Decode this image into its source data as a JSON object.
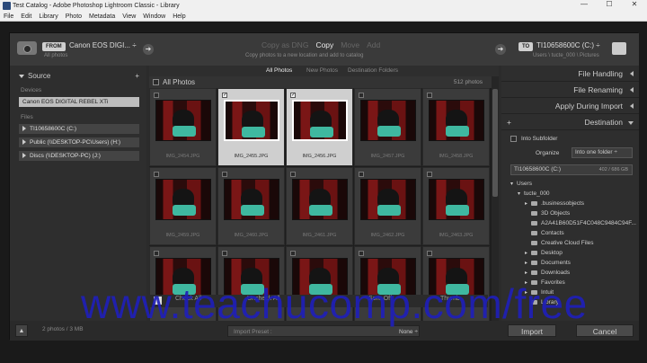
{
  "window": {
    "title": "Test Catalog - Adobe Photoshop Lightroom Classic - Library",
    "min": "—",
    "max": "☐",
    "close": "✕"
  },
  "menu": [
    "File",
    "Edit",
    "Library",
    "Photo",
    "Metadata",
    "View",
    "Window",
    "Help"
  ],
  "topbar": {
    "from_label": "FROM",
    "source_name": "Canon EOS DIGI... ÷",
    "source_sub": "All photos",
    "modes": [
      "Copy as DNG",
      "Copy",
      "Move",
      "Add"
    ],
    "active_mode": "Copy",
    "mode_sub": "Copy photos to a new location and add to catalog",
    "to_label": "TO",
    "dest_name": "TI10658600C (C:) ÷",
    "dest_sub": "Users \\ tucte_000 \\ Pictures",
    "arrow": "➜"
  },
  "source_panel": {
    "title": "Source",
    "plus": "+",
    "devices_label": "Devices",
    "device": "Canon EOS DIGITAL REBEL XTi",
    "files_label": "Files",
    "drives": [
      "TI10658600C (C:)",
      "Public (\\\\DESKTOP-PC\\Users) (H:)",
      "Discs (\\\\DESKTOP-PC) (J:)"
    ]
  },
  "tabs": [
    "All Photos",
    "New Photos",
    "Destination Folders"
  ],
  "active_tab": "All Photos",
  "grid": {
    "header": "All Photos",
    "count": "512 photos",
    "files": [
      {
        "name": "IMG_2454.JPG",
        "checked": false
      },
      {
        "name": "IMG_2455.JPG",
        "checked": true
      },
      {
        "name": "IMG_2456.JPG",
        "checked": true
      },
      {
        "name": "IMG_2457.JPG",
        "checked": false
      },
      {
        "name": "IMG_2458.JPG",
        "checked": false
      },
      {
        "name": "IMG_2459.JPG",
        "checked": false
      },
      {
        "name": "IMG_2460.JPG",
        "checked": false
      },
      {
        "name": "IMG_2461.JPG",
        "checked": false
      },
      {
        "name": "IMG_2462.JPG",
        "checked": false
      },
      {
        "name": "IMG_2463.JPG",
        "checked": false
      },
      {
        "name": "",
        "checked": false
      },
      {
        "name": "",
        "checked": false
      },
      {
        "name": "",
        "checked": false
      },
      {
        "name": "",
        "checked": false
      },
      {
        "name": "",
        "checked": false
      }
    ]
  },
  "right_panel": {
    "sections": [
      "File Handling",
      "File Renaming",
      "Apply During Import",
      "Destination"
    ],
    "plus": "+",
    "into_subfolder": "Into Subfolder",
    "organize_label": "Organize",
    "organize_value": "Into one folder ÷",
    "drive": "TI10658600C (C:)",
    "drive_space": "402 / 686 GB",
    "tree": [
      {
        "label": "Users",
        "level": 0,
        "expand": "▾"
      },
      {
        "label": "tucte_000",
        "level": 1,
        "expand": "▾"
      },
      {
        "label": ".businessobjects",
        "level": 2,
        "expand": "▸"
      },
      {
        "label": "3D Objects",
        "level": 2,
        "expand": ""
      },
      {
        "label": "A2A41B60D51F4C048C9484C94F...",
        "level": 2,
        "expand": ""
      },
      {
        "label": "Contacts",
        "level": 2,
        "expand": ""
      },
      {
        "label": "Creative Cloud Files",
        "level": 2,
        "expand": ""
      },
      {
        "label": "Desktop",
        "level": 2,
        "expand": "▸"
      },
      {
        "label": "Documents",
        "level": 2,
        "expand": "▸"
      },
      {
        "label": "Downloads",
        "level": 2,
        "expand": "▸"
      },
      {
        "label": "Favorites",
        "level": 2,
        "expand": "▸"
      },
      {
        "label": "Intuit",
        "level": 2,
        "expand": "▸"
      },
      {
        "label": "Library",
        "level": 2,
        "expand": ""
      }
    ]
  },
  "overlay_bar": {
    "check_all": "Check All",
    "uncheck_all": "Uncheck All",
    "sort": "Sort: Off",
    "thumbnail": "Thumb"
  },
  "footer": {
    "summary": "2 photos / 3 MB",
    "preset_label": "Import Preset :",
    "preset_value": "None ÷",
    "import_btn": "Import",
    "cancel_btn": "Cancel",
    "up": "▲"
  },
  "watermark": "www.teachucomp.com/free"
}
